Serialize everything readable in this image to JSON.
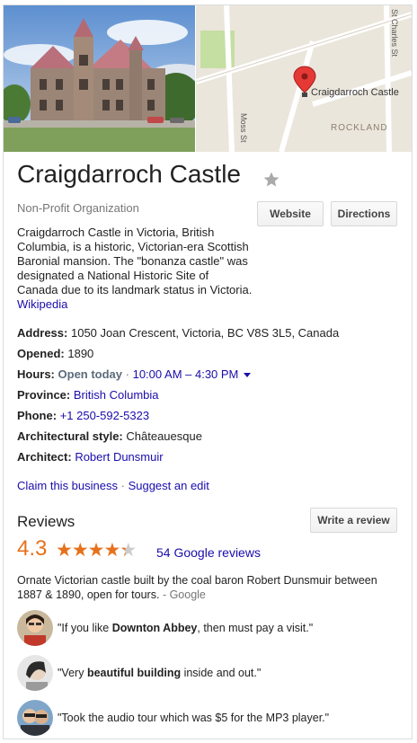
{
  "place": {
    "name": "Craigdarroch Castle",
    "category": "Non-Profit Organization",
    "description": "Craigdarroch Castle in Victoria, British Columbia, is a historic, Victorian-era Scottish Baronial mansion. The \"bonanza castle\" was designated a National Historic Site of Canada due to its landmark status in Victoria.",
    "description_link": "Wikipedia"
  },
  "buttons": {
    "website": "Website",
    "directions": "Directions",
    "write_review": "Write a review"
  },
  "map": {
    "pin_label": "Craigdarroch Castle",
    "streets": {
      "moss": "Moss St",
      "st_charles": "St Charles St"
    },
    "neighborhood": "ROCKLAND"
  },
  "facts": {
    "address_label": "Address:",
    "address_value": "1050 Joan Crescent, Victoria, BC V8S 3L5, Canada",
    "opened_label": "Opened:",
    "opened_value": "1890",
    "hours_label": "Hours:",
    "hours_status": "Open today",
    "hours_sep": " · ",
    "hours_value": "10:00 AM – 4:30 PM",
    "province_label": "Province:",
    "province_value": "British Columbia",
    "phone_label": "Phone:",
    "phone_value": "+1 250-592-5323",
    "style_label": "Architectural style:",
    "style_value": "Châteauesque",
    "architect_label": "Architect:",
    "architect_value": "Robert Dunsmuir"
  },
  "links": {
    "claim": "Claim this business",
    "sep": " · ",
    "suggest": "Suggest an edit"
  },
  "reviews": {
    "heading": "Reviews",
    "score": "4.3",
    "rating": 4.3,
    "count_text": "54 Google reviews",
    "summary": "Ornate Victorian castle built by the coal baron Robert Dunsmuir between 1887 & 1890, open for tours.",
    "summary_source": "- Google",
    "snippets": [
      {
        "pre": "\"If you like ",
        "bold": "Downton Abbey",
        "post": ", then must pay a visit.\""
      },
      {
        "pre": "\"Very ",
        "bold": "beautiful building",
        "post": " inside and out.\""
      },
      {
        "pre": "\"Took the audio tour which was $5 for the MP3 player.\"",
        "bold": "",
        "post": ""
      }
    ]
  },
  "colors": {
    "link": "#1a0dab",
    "rating": "#e7711b",
    "muted": "#777777",
    "pin": "#e53935"
  }
}
